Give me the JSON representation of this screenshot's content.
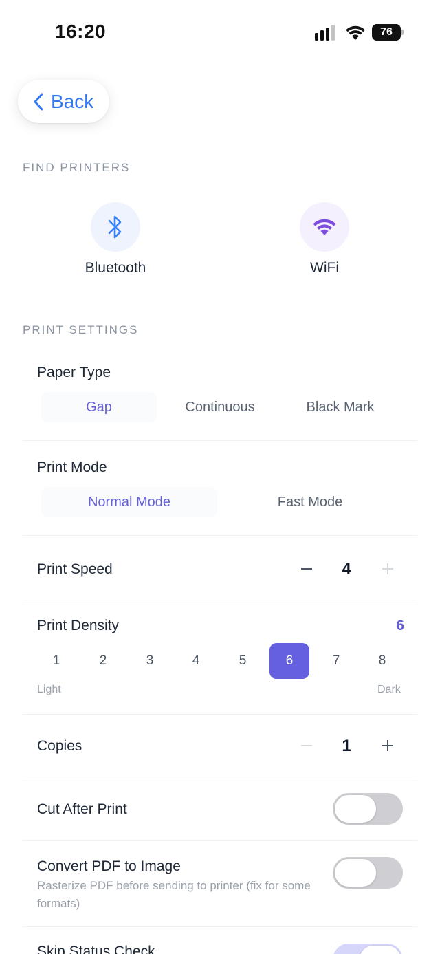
{
  "status_bar": {
    "time": "16:20",
    "battery": "76"
  },
  "nav": {
    "back_label": "Back"
  },
  "find_printers": {
    "section": "FIND PRINTERS",
    "bluetooth": {
      "label": "Bluetooth",
      "icon": "bluetooth-icon",
      "color": "#3b82f6"
    },
    "wifi": {
      "label": "WiFi",
      "icon": "wifi-icon",
      "color": "#7c4ddf"
    }
  },
  "print_settings": {
    "section": "PRINT SETTINGS",
    "paper_type": {
      "label": "Paper Type",
      "options": [
        "Gap",
        "Continuous",
        "Black Mark"
      ],
      "selected": "Gap"
    },
    "print_mode": {
      "label": "Print Mode",
      "options": [
        "Normal Mode",
        "Fast Mode"
      ],
      "selected": "Normal Mode"
    },
    "print_speed": {
      "label": "Print Speed",
      "value": "4"
    },
    "print_density": {
      "label": "Print Density",
      "value": "6",
      "options": [
        "1",
        "2",
        "3",
        "4",
        "5",
        "6",
        "7",
        "8"
      ],
      "low_label": "Light",
      "high_label": "Dark"
    },
    "copies": {
      "label": "Copies",
      "value": "1"
    },
    "cut_after_print": {
      "label": "Cut After Print",
      "enabled": false
    },
    "convert_pdf": {
      "label": "Convert PDF to Image",
      "description": "Rasterize PDF before sending to printer (fix for some formats)",
      "enabled": false
    },
    "skip_status_check": {
      "label": "Skip Status Check",
      "enabled": true
    }
  },
  "colors": {
    "accent": "#6560e0",
    "link": "#3478f6"
  }
}
